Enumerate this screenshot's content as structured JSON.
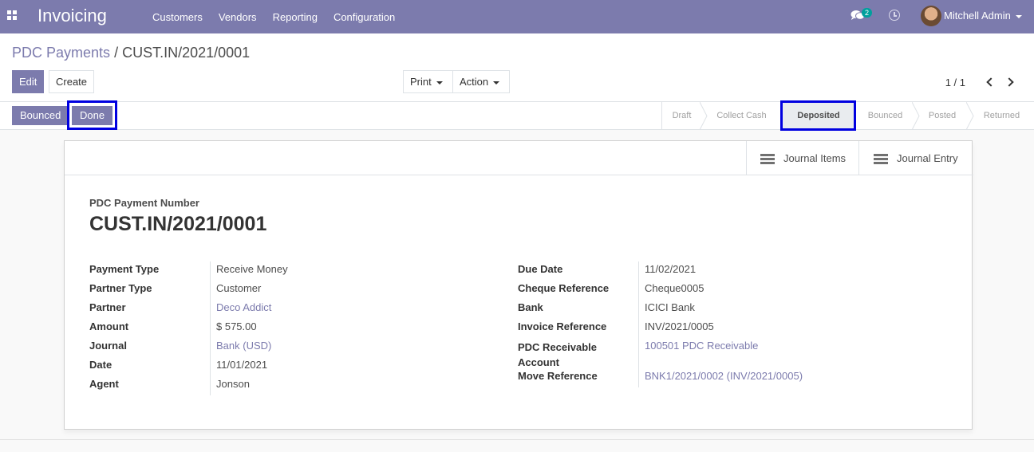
{
  "navbar": {
    "app_name": "Invoicing",
    "menu": [
      "Customers",
      "Vendors",
      "Reporting",
      "Configuration"
    ],
    "chat_count": "2",
    "user_name": "Mitchell Admin"
  },
  "breadcrumb": {
    "parent": "PDC Payments",
    "separator": "/",
    "current": "CUST.IN/2021/0001"
  },
  "control": {
    "edit_label": "Edit",
    "create_label": "Create",
    "print_label": "Print",
    "action_label": "Action",
    "pager": "1 / 1"
  },
  "statusbar": {
    "buttons": [
      "Bounced",
      "Done"
    ],
    "stages": [
      "Draft",
      "Collect Cash",
      "Deposited",
      "Bounced",
      "Posted",
      "Returned"
    ],
    "active_stage": "Deposited"
  },
  "smart_buttons": {
    "journal_items": "Journal Items",
    "journal_entry": "Journal Entry"
  },
  "form": {
    "number_label": "PDC Payment Number",
    "number": "CUST.IN/2021/0001",
    "left": [
      {
        "label": "Payment Type",
        "value": "Receive Money"
      },
      {
        "label": "Partner Type",
        "value": "Customer"
      },
      {
        "label": "Partner",
        "value": "Deco Addict"
      },
      {
        "label": "Amount",
        "value": "$ 575.00"
      },
      {
        "label": "Journal",
        "value": "Bank (USD)"
      },
      {
        "label": "Date",
        "value": "11/01/2021"
      },
      {
        "label": "Agent",
        "value": "Jonson"
      }
    ],
    "right": [
      {
        "label": "Due Date",
        "value": "11/02/2021"
      },
      {
        "label": "Cheque Reference",
        "value": "Cheque0005"
      },
      {
        "label": "Bank",
        "value": "ICICI Bank"
      },
      {
        "label": "Invoice Reference",
        "value": "INV/2021/0005"
      },
      {
        "label": "PDC Receivable Account",
        "value": "100501 PDC Receivable"
      },
      {
        "label": "Move Reference",
        "value": "BNK1/2021/0002 (INV/2021/0005)"
      }
    ]
  },
  "colors": {
    "brand": "#7c7bad",
    "highlight": "#0000e0"
  }
}
